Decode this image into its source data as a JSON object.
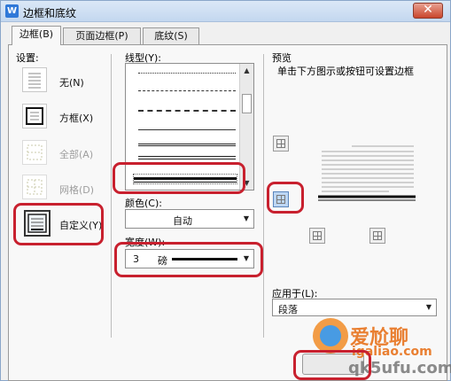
{
  "window": {
    "title": "边框和底纹",
    "app_icon": "W",
    "close_label": "✕"
  },
  "tabs": [
    {
      "label": "边框(B)",
      "active": true
    },
    {
      "label": "页面边框(P)",
      "active": false
    },
    {
      "label": "底纹(S)",
      "active": false
    }
  ],
  "settings": {
    "label": "设置:",
    "items": [
      {
        "label": "无(N)",
        "enabled": true
      },
      {
        "label": "方框(X)",
        "enabled": true
      },
      {
        "label": "全部(A)",
        "enabled": false
      },
      {
        "label": "网格(D)",
        "enabled": false
      },
      {
        "label": "自定义(Y)",
        "enabled": true,
        "selected": true
      }
    ]
  },
  "line_style": {
    "label": "线型(Y):"
  },
  "color": {
    "label": "颜色(C):",
    "value": "自动"
  },
  "width": {
    "label": "宽度(W):",
    "value": "3",
    "unit": "磅"
  },
  "preview": {
    "label": "预览",
    "hint": "单击下方图示或按钮可设置边框",
    "apply_label": "应用于(L):",
    "apply_value": "段落"
  },
  "watermark": {
    "line1": "爱尬聊",
    "line2": "igaliao.com",
    "line3": "qk5ufu.com"
  },
  "colors": {
    "annotation": "#c8202e",
    "active_tab": "#f8f8f8",
    "selected_button": "#bcd6f3"
  }
}
